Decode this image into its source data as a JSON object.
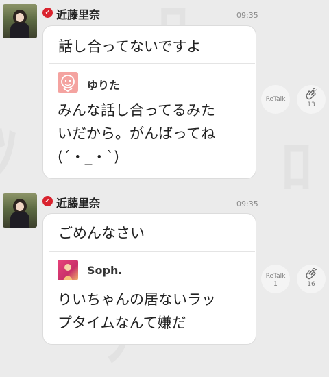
{
  "posts": [
    {
      "author": "近藤里奈",
      "verified_icon": "check-icon",
      "time": "09:35",
      "message": "話し合ってないですよ",
      "quote": {
        "name": "ゆりた",
        "avatar_icon": "pink-character-icon",
        "lines": [
          "みんな話し合ってるみた",
          "いだから。がんばってね",
          "(´・_・`)"
        ]
      },
      "retalk_label": "ReTalk",
      "retalk_count": "",
      "clap_count": "13"
    },
    {
      "author": "近藤里奈",
      "verified_icon": "check-icon",
      "time": "09:35",
      "message": "ごめんなさい",
      "quote": {
        "name": "Soph.",
        "avatar_icon": "photo-avatar-icon",
        "lines": [
          "りいちゃんの居ないラッ",
          "プタイムなんて嫌だ"
        ]
      },
      "retalk_label": "ReTalk",
      "retalk_count": "1",
      "clap_count": "16"
    }
  ],
  "colors": {
    "verified": "#d9232e",
    "background": "#ebebeb"
  }
}
